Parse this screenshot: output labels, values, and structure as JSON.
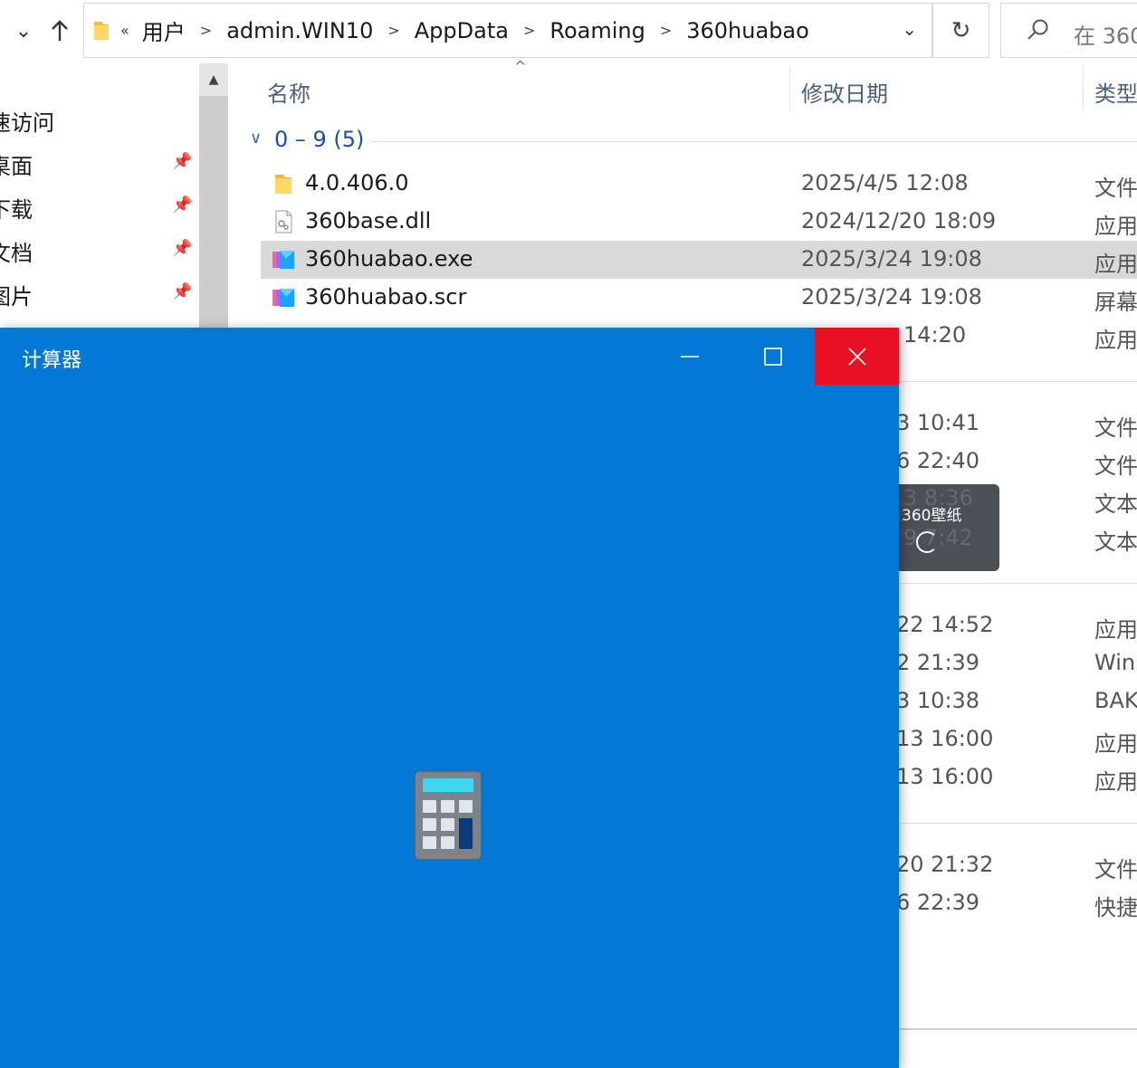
{
  "explorer": {
    "address": {
      "overflow_label": "«",
      "crumbs": [
        "用户",
        "admin.WIN10",
        "AppData",
        "Roaming",
        "360huabao"
      ]
    },
    "search_placeholder": "在 360",
    "nav_items": [
      {
        "label": "速访问",
        "pinned": false
      },
      {
        "label": "桌面",
        "pinned": true
      },
      {
        "label": "下载",
        "pinned": true
      },
      {
        "label": "文档",
        "pinned": true
      },
      {
        "label": "图片",
        "pinned": true
      }
    ],
    "columns": {
      "name": "名称",
      "date": "修改日期",
      "type": "类型"
    },
    "group": {
      "name": "0 – 9 (5)"
    },
    "files": [
      {
        "name": "4.0.406.0",
        "date": "2025/4/5 12:08",
        "type": "文件",
        "icon": "folder-icon",
        "selected": false
      },
      {
        "name": "360base.dll",
        "date": "2024/12/20 18:09",
        "type": "应用",
        "icon": "dll-file-icon",
        "selected": false
      },
      {
        "name": "360huabao.exe",
        "date": "2025/3/24 19:08",
        "type": "应用",
        "icon": "app-icon",
        "selected": true
      },
      {
        "name": "360huabao.scr",
        "date": "2025/3/24 19:08",
        "type": "屏幕",
        "icon": "app-icon",
        "selected": false
      }
    ],
    "partial_rows": [
      {
        "date": "14:20",
        "type": "应用"
      },
      {
        "date": "3 10:41",
        "type": "文件"
      },
      {
        "date": "6 22:40",
        "type": "文件"
      },
      {
        "date": "",
        "type": "文本"
      },
      {
        "date": "",
        "type": "文本"
      },
      {
        "date": "22 14:52",
        "type": "应用"
      },
      {
        "date": "2 21:39",
        "type": "Win"
      },
      {
        "date": "3 10:38",
        "type": "BAK"
      },
      {
        "date": "13 16:00",
        "type": "应用"
      },
      {
        "date": "13 16:00",
        "type": "应用"
      },
      {
        "date": "20 21:32",
        "type": "文件"
      },
      {
        "date": "6 22:39",
        "type": "快捷"
      }
    ],
    "obscured_dates": [
      "3 8:36",
      "9 7:42"
    ]
  },
  "wallpaper_popup": {
    "logo": "360壁纸"
  },
  "calculator": {
    "title": "计算器"
  },
  "colors": {
    "accent": "#0078d4",
    "close_red": "#e81123",
    "selection": "#d9d9d9",
    "group_blue": "#1e4f9c"
  }
}
